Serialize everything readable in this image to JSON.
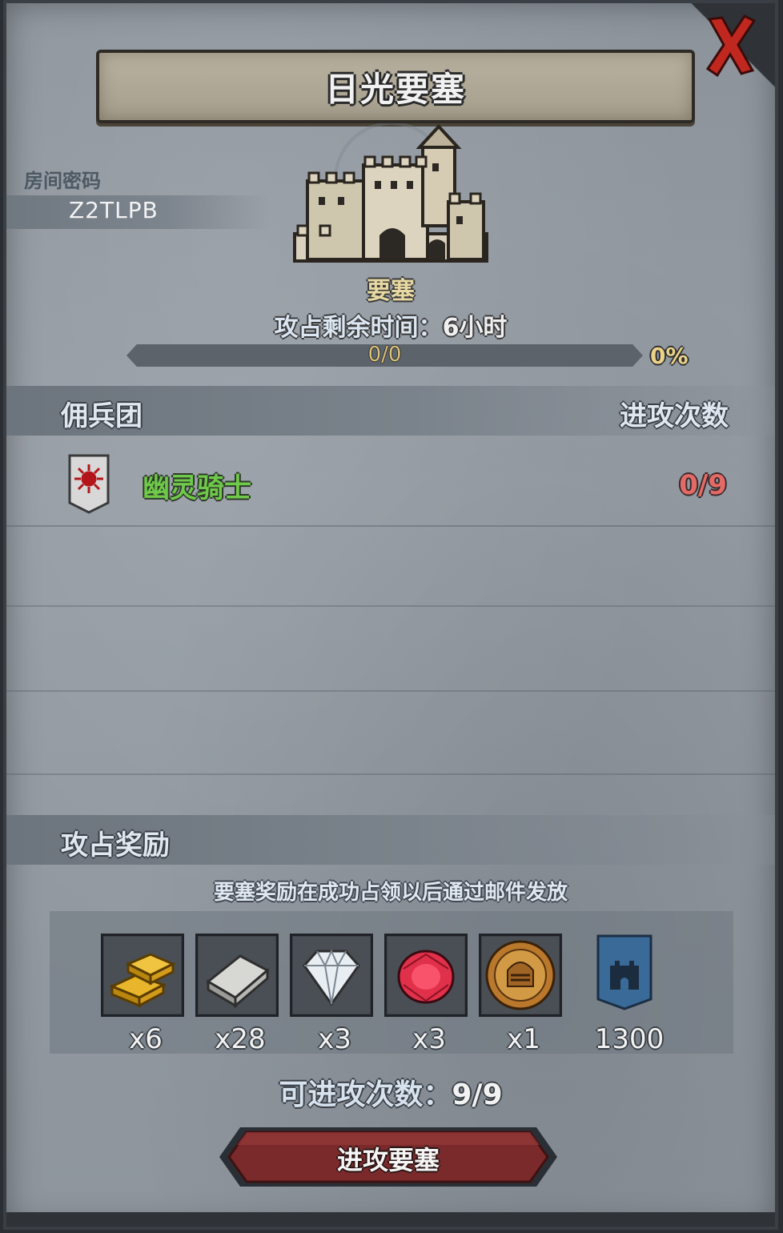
{
  "header": {
    "title": "日光要塞",
    "close_icon": "close-x-icon"
  },
  "room": {
    "label": "房间密码",
    "code": "Z2TLPB"
  },
  "fortress": {
    "type_label": "要塞",
    "timer_label": "攻占剩余时间：",
    "timer_value": "6小时",
    "progress_text": "0/0",
    "progress_percent_text": "0%",
    "progress_fraction": 0
  },
  "mercenary": {
    "section_title": "佣兵团",
    "attack_header": "进攻次数",
    "items": [
      {
        "name": "幽灵骑士",
        "count": "0/9",
        "icon": "red-sun-banner-icon",
        "color": "#6fc94a"
      }
    ]
  },
  "rewards": {
    "section_title": "攻占奖励",
    "note": "要塞奖励在成功占领以后通过邮件发放",
    "items": [
      {
        "icon": "gold-bars-icon",
        "qty": "x6"
      },
      {
        "icon": "silver-ingot-icon",
        "qty": "x28"
      },
      {
        "icon": "diamond-icon",
        "qty": "x3"
      },
      {
        "icon": "ruby-icon",
        "qty": "x3"
      },
      {
        "icon": "knight-helmet-coin-icon",
        "qty": "x1"
      },
      {
        "icon": "castle-banner-icon",
        "qty": "1300"
      }
    ]
  },
  "footer": {
    "attack_count_label": "可进攻次数：",
    "attack_count_value": "9/9",
    "attack_button": "进攻要塞"
  },
  "colors": {
    "merc_name": "#6fc94a",
    "merc_count": "#e36a66",
    "button_red": "#7a2a2a",
    "progress_text": "#d9c27a"
  }
}
